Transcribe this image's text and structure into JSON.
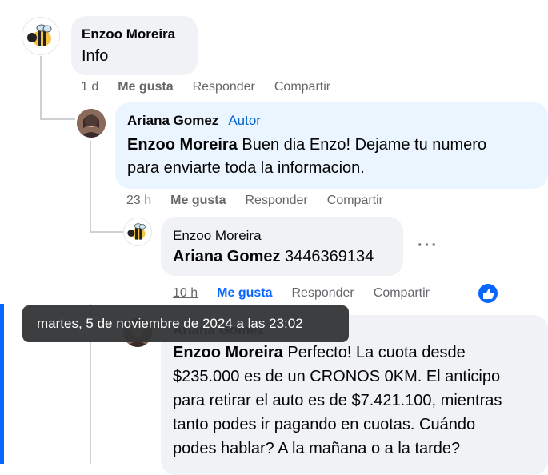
{
  "comments": [
    {
      "author": "Enzoo Moreira",
      "text": "Info",
      "time": "1 d",
      "actions": {
        "like": "Me gusta",
        "reply": "Responder",
        "share": "Compartir"
      }
    },
    {
      "author": "Ariana Gomez",
      "author_tag": "Autor",
      "mention": "Enzoo Moreira",
      "text_line1": " Buen dia Enzo! Dejame tu numero",
      "text_line2": "para enviarte toda la informacion.",
      "time": "23 h",
      "actions": {
        "like": "Me gusta",
        "reply": "Responder",
        "share": "Compartir"
      }
    },
    {
      "author": "Enzoo Moreira",
      "mention": "Ariana Gomez",
      "text": " 3446369134",
      "time": "10 h",
      "actions": {
        "like": "Me gusta",
        "reply": "Responder",
        "share": "Compartir"
      },
      "more_label": "···",
      "reaction_icon": "thumbs-up-icon"
    },
    {
      "author": "Ariana Gomez",
      "mention": "Enzoo Moreira",
      "text_line1": " Perfecto! La cuota desde",
      "text_line2": "$235.000 es de un CRONOS 0KM. El anticipo",
      "text_line3": "para retirar el auto es de $7.421.100, mientras",
      "text_line4": "tanto podes ir pagando en cuotas. Cuándo",
      "text_line5": "podes hablar? A la mañana o a la tarde?"
    }
  ],
  "tooltip": "martes, 5 de noviembre de 2024 a las 23:02",
  "colors": {
    "accent": "#0866ff",
    "bubble_grey": "#f0f2f5",
    "bubble_blue": "#ebf5ff"
  }
}
